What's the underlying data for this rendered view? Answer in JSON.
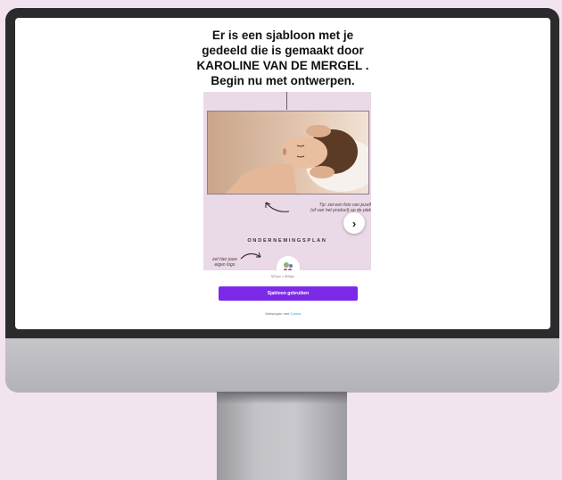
{
  "headline": {
    "line1": "Er is een sjabloon met je",
    "line2": "gedeeld die is gemaakt door",
    "line3": "KAROLINE VAN DE MERGEL .",
    "line4": "Begin nu met ontwerpen."
  },
  "template_preview": {
    "tip_line1": "Tip: zet een foto van jezelf",
    "tip_line2": "(of van het product) op de plek",
    "next_glyph": "›",
    "section_title": "ONDERNEMINGSPLAN",
    "logo_hint_line1": "zet hier jouw",
    "logo_hint_line2": "eigen logo"
  },
  "dimensions": "522px × 800px",
  "cta": {
    "label": "Sjabloon gebruiken"
  },
  "footer": {
    "prefix": "Ontworpen met",
    "brand": "Canva"
  },
  "colors": {
    "background": "#f1e4ee",
    "card": "#ead9e6",
    "button": "#7d2ae8"
  }
}
